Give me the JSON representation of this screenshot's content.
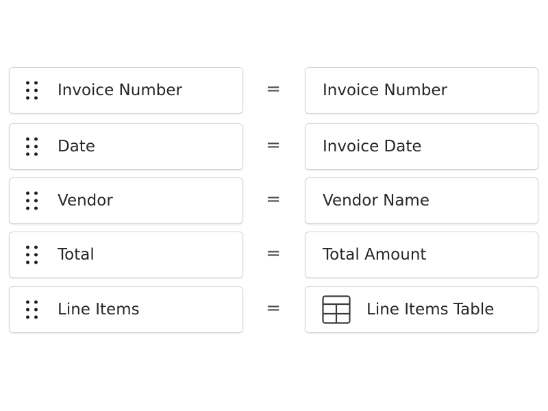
{
  "mappings": [
    {
      "source": "Invoice Number",
      "operator": "=",
      "target": "Invoice Number"
    },
    {
      "source": "Date",
      "operator": "=",
      "target": "Invoice Date"
    },
    {
      "source": "Vendor",
      "operator": "=",
      "target": "Vendor Name"
    },
    {
      "source": "Total",
      "operator": "=",
      "target": "Total Amount"
    },
    {
      "source": "Line Items",
      "operator": "=",
      "target": "Line Items Table",
      "target_icon": "table-icon"
    }
  ],
  "colors": {
    "border": "#d4d4d4",
    "text": "#262626",
    "handle_dots": "#1f1f1f",
    "operator": "#4a4a4a"
  }
}
